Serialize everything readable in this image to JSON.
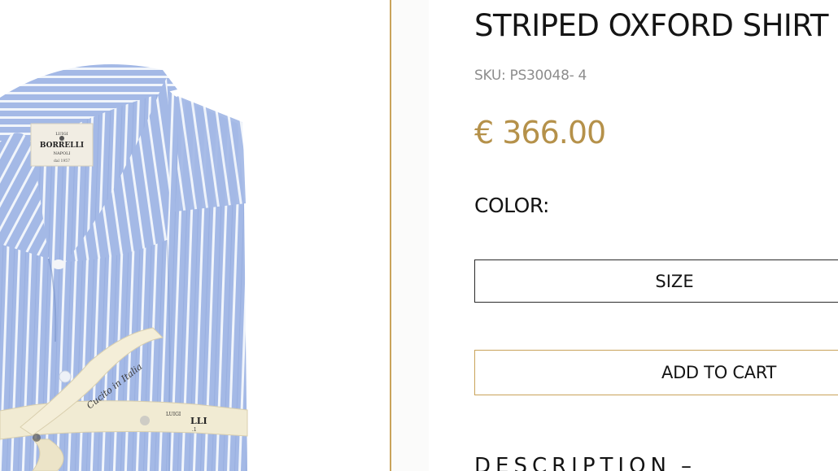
{
  "product": {
    "title": "STRIPED OXFORD SHIRT",
    "sku": "SKU: PS30048- 4",
    "price": "€ 366.00"
  },
  "options": {
    "color_label": "COLOR:",
    "size_button": "SIZE"
  },
  "actions": {
    "add_to_cart": "ADD TO CART"
  },
  "sections": {
    "description_label": "DESCRIPTION",
    "description_toggle": "–"
  },
  "image": {
    "label_brand_small": "LUIGI",
    "label_brand": "BORRELLI",
    "label_city": "NAPOLI",
    "label_year": "dal 1957",
    "ribbon_text": "Cucito in Italia",
    "ribbon_brand_small": "LUIGI",
    "ribbon_brand": "LLI",
    "ribbon_tail": ".1"
  },
  "colors": {
    "accent_gold": "#b5914a",
    "divider_gold": "#c9a35a",
    "shirt_blue": "#9db5e3",
    "stripe_white": "#ffffff",
    "ribbon_cream": "#f2ecd7"
  }
}
